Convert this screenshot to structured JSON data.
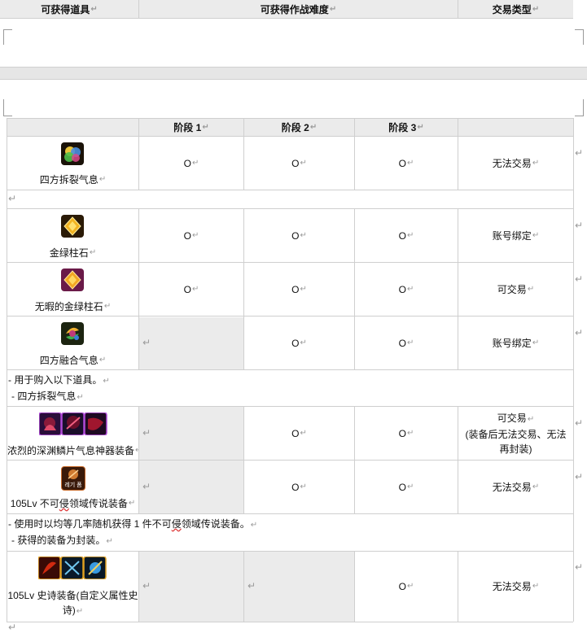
{
  "top_header": {
    "col1": "可获得道具",
    "col2": "可获得作战难度",
    "col3": "交易类型"
  },
  "stage_header": {
    "stage1": "阶段 1",
    "stage2": "阶段 2",
    "stage3": "阶段 3"
  },
  "cell_mark": "O",
  "items": [
    {
      "name": "四方拆裂气息",
      "icon": "four-way-split-aura-icon",
      "s1": "O",
      "s2": "O",
      "s3": "O",
      "trade": "无法交易"
    },
    {
      "name": "金绿柱石",
      "icon": "chrysoberyl-icon",
      "s1": "O",
      "s2": "O",
      "s3": "O",
      "trade": "账号绑定"
    },
    {
      "name": "无暇的金绿柱石",
      "icon": "flawless-chrysoberyl-icon",
      "s1": "O",
      "s2": "O",
      "s3": "O",
      "trade": "可交易"
    },
    {
      "name": "四方融合气息",
      "icon": "four-way-fusion-aura-icon",
      "s1": "",
      "s2": "O",
      "s3": "O",
      "trade": "账号绑定"
    },
    {
      "name": "浓烈的深渊鳞片气息神器装备",
      "icon": "abyss-scale-artifact-icons",
      "s1": "",
      "s2": "O",
      "s3": "O",
      "trade_lines": [
        "可交易",
        "(装备后无法交易、无法",
        "再封装)"
      ]
    },
    {
      "name_prefix": "105Lv 不可",
      "name_wavy": "侵",
      "name_suffix": "领域传说装备",
      "icon": "legendary-equipment-icon",
      "icon_label": "레기 폼",
      "s1": "",
      "s2": "O",
      "s3": "O",
      "trade": "无法交易"
    },
    {
      "name_lines": [
        "105Lv 史诗装备(自定义属性史",
        "诗)"
      ],
      "icon": "epic-equipment-icons",
      "s1": "",
      "s2": "",
      "s3": "O",
      "trade": "无法交易"
    }
  ],
  "notes": {
    "fusion_note_1": "-  用于购入以下道具。",
    "fusion_note_2": "-  四方拆裂气息",
    "legend_note_1_prefix": "-  使用时以均等几率随机获得 1 件不可",
    "legend_note_1_wavy": "侵",
    "legend_note_1_suffix": "领域传说装备。",
    "legend_note_2": "-  获得的装备为封装。"
  },
  "marks": {
    "return": "↵",
    "paragraph": "↵"
  },
  "colors": {
    "header_bg": "#ebebeb",
    "grid": "#cfcfcf",
    "mark": "#9a9a9a",
    "spell_underline": "#d33"
  }
}
